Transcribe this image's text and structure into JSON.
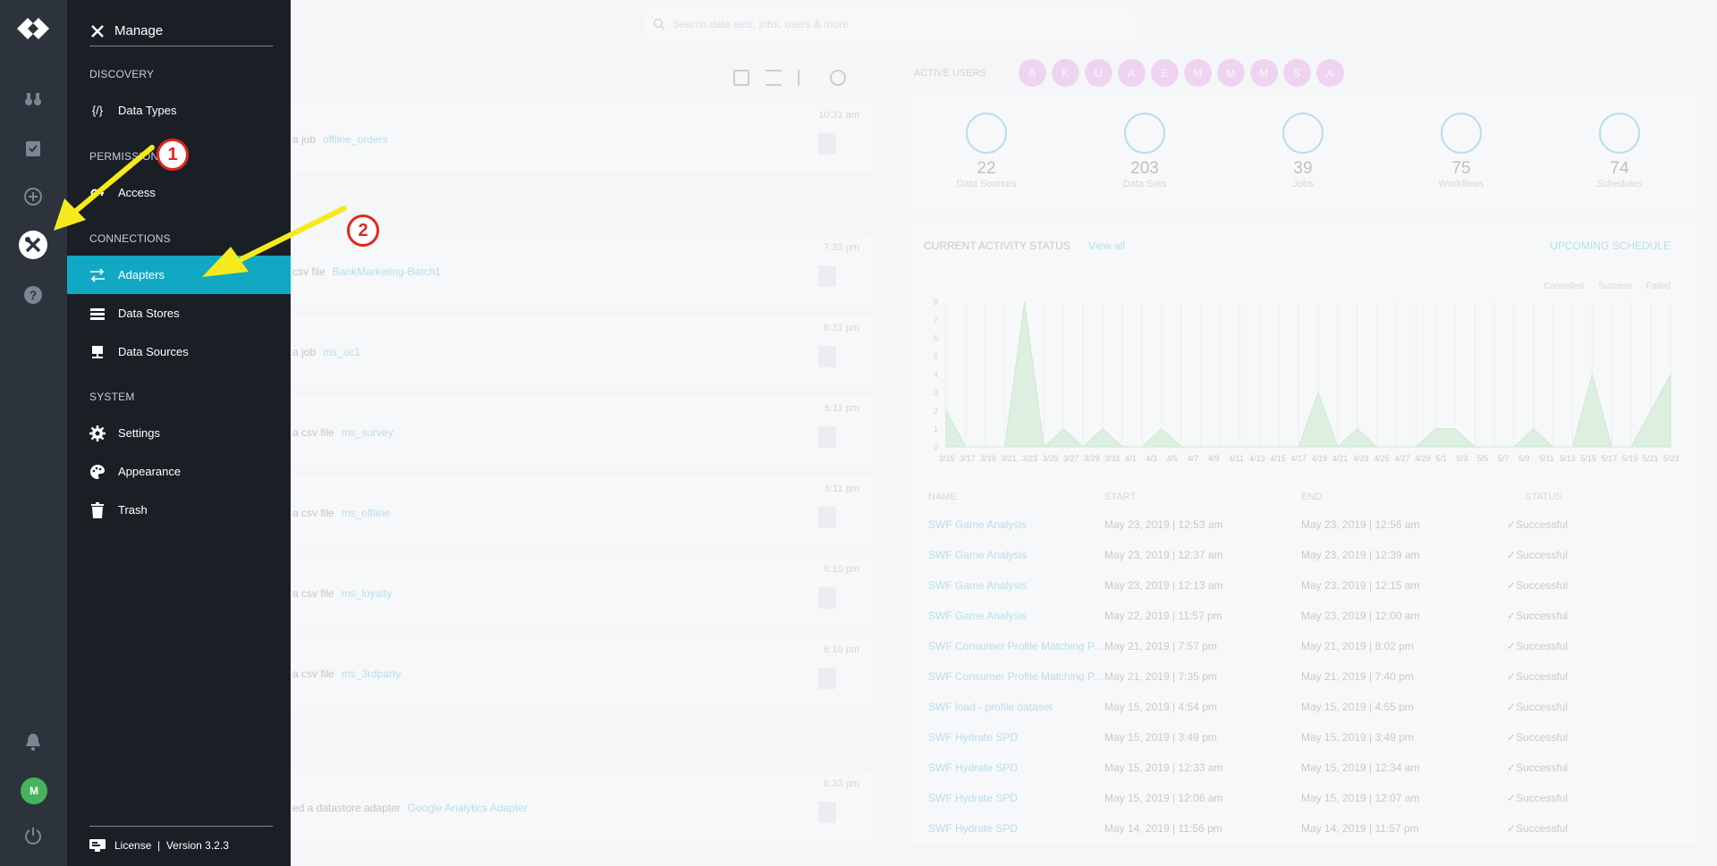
{
  "app": {
    "title": "Manage"
  },
  "rail": {
    "avatar_initial": "M"
  },
  "menu": {
    "title": "Manage",
    "sections": [
      {
        "label": "DISCOVERY"
      },
      {
        "label": "PERMISSIONS"
      },
      {
        "label": "CONNECTIONS"
      },
      {
        "label": "SYSTEM"
      }
    ],
    "items": [
      {
        "label": "Data Types",
        "icon": "code-braces-icon"
      },
      {
        "label": "Access",
        "icon": "key-icon"
      },
      {
        "label": "Adapters",
        "icon": "adapter-arrows-icon",
        "selected": true
      },
      {
        "label": "Data Stores",
        "icon": "database-stack-icon"
      },
      {
        "label": "Data Sources",
        "icon": "monitor-source-icon"
      },
      {
        "label": "Settings",
        "icon": "gear-icon"
      },
      {
        "label": "Appearance",
        "icon": "palette-icon"
      },
      {
        "label": "Trash",
        "icon": "trash-icon"
      }
    ],
    "footer": "License  |  Version 3.2.3"
  },
  "search": {
    "placeholder": "Search data sets, jobs, users & more"
  },
  "feed": [
    {
      "action": "a job",
      "link": "offline_orders",
      "time": "10:31 am"
    },
    {
      "action": "csv file",
      "link": "BankMarketing-Batch1",
      "time": "7:33 pm"
    },
    {
      "action": "a job",
      "link": "ms_uc1",
      "time": "6:31 pm"
    },
    {
      "action": "a csv file",
      "link": "ms_survey",
      "time": "6:11 pm"
    },
    {
      "action": "a csv file",
      "link": "ms_offline",
      "time": "6:11 pm"
    },
    {
      "action": "a csv file",
      "link": "ms_loyalty",
      "time": "6:10 pm"
    },
    {
      "action": "a csv file",
      "link": "ms_3rdparty",
      "time": "6:10 pm"
    },
    {
      "action": "ed a datastore adapter",
      "link": "Google Analytics Adapter",
      "time": "6:33 pm"
    }
  ],
  "active_users": {
    "label": "ACTIVE USERS",
    "initials": [
      "A",
      "K",
      "U",
      "A",
      "E",
      "M",
      "M",
      "M",
      "S",
      "A"
    ]
  },
  "stats": [
    {
      "value": "22",
      "label": "Data Sources"
    },
    {
      "value": "203",
      "label": "Data Sets"
    },
    {
      "value": "39",
      "label": "Jobs"
    },
    {
      "value": "75",
      "label": "Workflows"
    },
    {
      "value": "74",
      "label": "Schedules"
    }
  ],
  "activity": {
    "title": "CURRENT ACTIVITY STATUS",
    "view_all": "View all",
    "upcoming": "UPCOMING SCHEDULE",
    "legend": [
      "Cancelled",
      "Success",
      "Failed"
    ],
    "columns": [
      "NAME",
      "START",
      "END",
      "STATUS"
    ],
    "rows": [
      {
        "name": "SWF Game Analysis",
        "start": "May 23, 2019 | 12:53 am",
        "end": "May 23, 2019 | 12:56 am",
        "status": "Successful"
      },
      {
        "name": "SWF Game Analysis",
        "start": "May 23, 2019 | 12:37 am",
        "end": "May 23, 2019 | 12:39 am",
        "status": "Successful"
      },
      {
        "name": "SWF Game Analysis",
        "start": "May 23, 2019 | 12:13 am",
        "end": "May 23, 2019 | 12:15 am",
        "status": "Successful"
      },
      {
        "name": "SWF Game Analysis",
        "start": "May 22, 2019 | 11:57 pm",
        "end": "May 23, 2019 | 12:00 am",
        "status": "Successful"
      },
      {
        "name": "SWF Consumer Profile Matching P...",
        "start": "May 21, 2019 | 7:57 pm",
        "end": "May 21, 2019 | 8:02 pm",
        "status": "Successful"
      },
      {
        "name": "SWF Consumer Profile Matching P...",
        "start": "May 21, 2019 | 7:35 pm",
        "end": "May 21, 2019 | 7:40 pm",
        "status": "Successful"
      },
      {
        "name": "SWF load - profile dataset",
        "start": "May 15, 2019 | 4:54 pm",
        "end": "May 15, 2019 | 4:55 pm",
        "status": "Successful"
      },
      {
        "name": "SWF Hydrate SPD",
        "start": "May 15, 2019 | 3:49 pm",
        "end": "May 15, 2019 | 3:49 pm",
        "status": "Successful"
      },
      {
        "name": "SWF Hydrate SPD",
        "start": "May 15, 2019 | 12:33 am",
        "end": "May 15, 2019 | 12:34 am",
        "status": "Successful"
      },
      {
        "name": "SWF Hydrate SPD",
        "start": "May 15, 2019 | 12:06 am",
        "end": "May 15, 2019 | 12:07 am",
        "status": "Successful"
      },
      {
        "name": "SWF Hydrate SPD",
        "start": "May 14, 2019 | 11:56 pm",
        "end": "May 14, 2019 | 11:57 pm",
        "status": "Successful"
      }
    ]
  },
  "annotations": {
    "badge1": "1",
    "badge2": "2"
  },
  "colors": {
    "accent": "#11a8c3",
    "rail": "#2c333d",
    "menu": "#1a1f26",
    "arrow": "#f5ea1c",
    "badge": "#e5251b"
  },
  "chart_data": {
    "type": "area",
    "x": [
      "3/15",
      "3/17",
      "3/19",
      "3/21",
      "3/23",
      "3/25",
      "3/27",
      "3/29",
      "3/31",
      "4/1",
      "4/3",
      "4/5",
      "4/7",
      "4/9",
      "4/11",
      "4/13",
      "4/15",
      "4/17",
      "4/19",
      "4/21",
      "4/23",
      "4/25",
      "4/27",
      "4/29",
      "5/1",
      "5/3",
      "5/5",
      "5/7",
      "5/9",
      "5/11",
      "5/13",
      "5/15",
      "5/17",
      "5/19",
      "5/21",
      "5/23"
    ],
    "ylim": [
      0,
      8
    ],
    "yticks": [
      0,
      1,
      2,
      3,
      4,
      5,
      6,
      7,
      8
    ],
    "series": [
      {
        "name": "Success",
        "values": [
          2,
          0,
          0,
          0,
          8,
          0,
          1,
          0,
          1,
          0,
          0,
          1,
          0,
          0,
          0,
          0,
          0,
          0,
          0,
          3,
          0,
          1,
          0,
          0,
          0,
          1,
          1,
          0,
          0,
          0,
          1,
          0,
          0,
          4,
          0,
          0,
          2,
          4
        ]
      }
    ]
  }
}
